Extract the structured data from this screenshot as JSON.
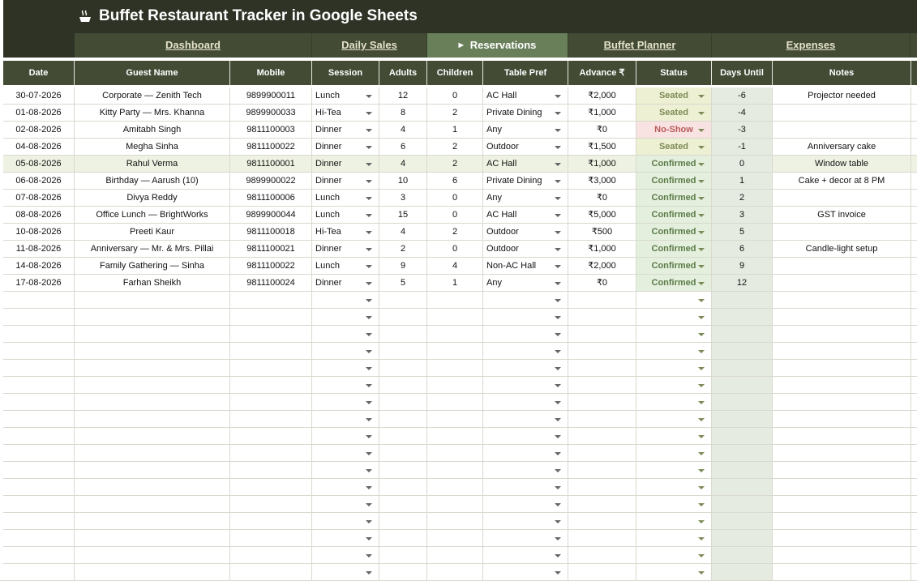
{
  "title": "Buffet Restaurant Tracker in Google Sheets",
  "nav": [
    {
      "label": "Dashboard",
      "active": false
    },
    {
      "label": "Daily Sales",
      "active": false
    },
    {
      "label": "Reservations",
      "active": true
    },
    {
      "label": "Buffet Planner",
      "active": false
    },
    {
      "label": "Expenses",
      "active": false
    }
  ],
  "columns": [
    "Date",
    "Guest Name",
    "Mobile",
    "Session",
    "Adults",
    "Children",
    "Table Pref",
    "Advance ₹",
    "Status",
    "Days Until",
    "Notes"
  ],
  "rows": [
    [
      "30-07-2026",
      "Corporate — Zenith Tech",
      "9899900011",
      "Lunch",
      "12",
      "0",
      "AC Hall",
      "₹2,000",
      "Seated",
      "-6",
      "Projector needed"
    ],
    [
      "01-08-2026",
      "Kitty Party — Mrs. Khanna",
      "9899900033",
      "Hi-Tea",
      "8",
      "2",
      "Private Dining",
      "₹1,000",
      "Seated",
      "-4",
      ""
    ],
    [
      "02-08-2026",
      "Amitabh Singh",
      "9811100003",
      "Dinner",
      "4",
      "1",
      "Any",
      "₹0",
      "No-Show",
      "-3",
      ""
    ],
    [
      "04-08-2026",
      "Megha Sinha",
      "9811100022",
      "Dinner",
      "6",
      "2",
      "Outdoor",
      "₹1,500",
      "Seated",
      "-1",
      "Anniversary cake"
    ],
    [
      "05-08-2026",
      "Rahul Verma",
      "9811100001",
      "Dinner",
      "4",
      "2",
      "AC Hall",
      "₹1,000",
      "Confirmed",
      "0",
      "Window table"
    ],
    [
      "06-08-2026",
      "Birthday — Aarush (10)",
      "9899900022",
      "Dinner",
      "10",
      "6",
      "Private Dining",
      "₹3,000",
      "Confirmed",
      "1",
      "Cake + decor at 8 PM"
    ],
    [
      "07-08-2026",
      "Divya Reddy",
      "9811100006",
      "Lunch",
      "3",
      "0",
      "Any",
      "₹0",
      "Confirmed",
      "2",
      ""
    ],
    [
      "08-08-2026",
      "Office Lunch — BrightWorks",
      "9899900044",
      "Lunch",
      "15",
      "0",
      "AC Hall",
      "₹5,000",
      "Confirmed",
      "3",
      "GST invoice"
    ],
    [
      "10-08-2026",
      "Preeti Kaur",
      "9811100018",
      "Hi-Tea",
      "4",
      "2",
      "Outdoor",
      "₹500",
      "Confirmed",
      "5",
      ""
    ],
    [
      "11-08-2026",
      "Anniversary — Mr. & Mrs. Pillai",
      "9811100021",
      "Dinner",
      "2",
      "0",
      "Outdoor",
      "₹1,000",
      "Confirmed",
      "6",
      "Candle-light setup"
    ],
    [
      "14-08-2026",
      "Family Gathering — Sinha",
      "9811100022",
      "Lunch",
      "9",
      "4",
      "Non-AC Hall",
      "₹2,000",
      "Confirmed",
      "9",
      ""
    ],
    [
      "17-08-2026",
      "Farhan Sheikh",
      "9811100024",
      "Dinner",
      "5",
      "1",
      "Any",
      "₹0",
      "Confirmed",
      "12",
      ""
    ]
  ],
  "highlighted_row": 4,
  "colors": {
    "title_bg": "#2f3326",
    "nav_bg": "#434b35",
    "active_tab": "#697f5a",
    "header_bg": "#434b35",
    "seated": "#7c8a57",
    "no_show": "#bb5a5a",
    "confirmed": "#5b7b48"
  },
  "icons": [
    "cooking-pot-icon",
    "dropdown-arrow-icon"
  ]
}
